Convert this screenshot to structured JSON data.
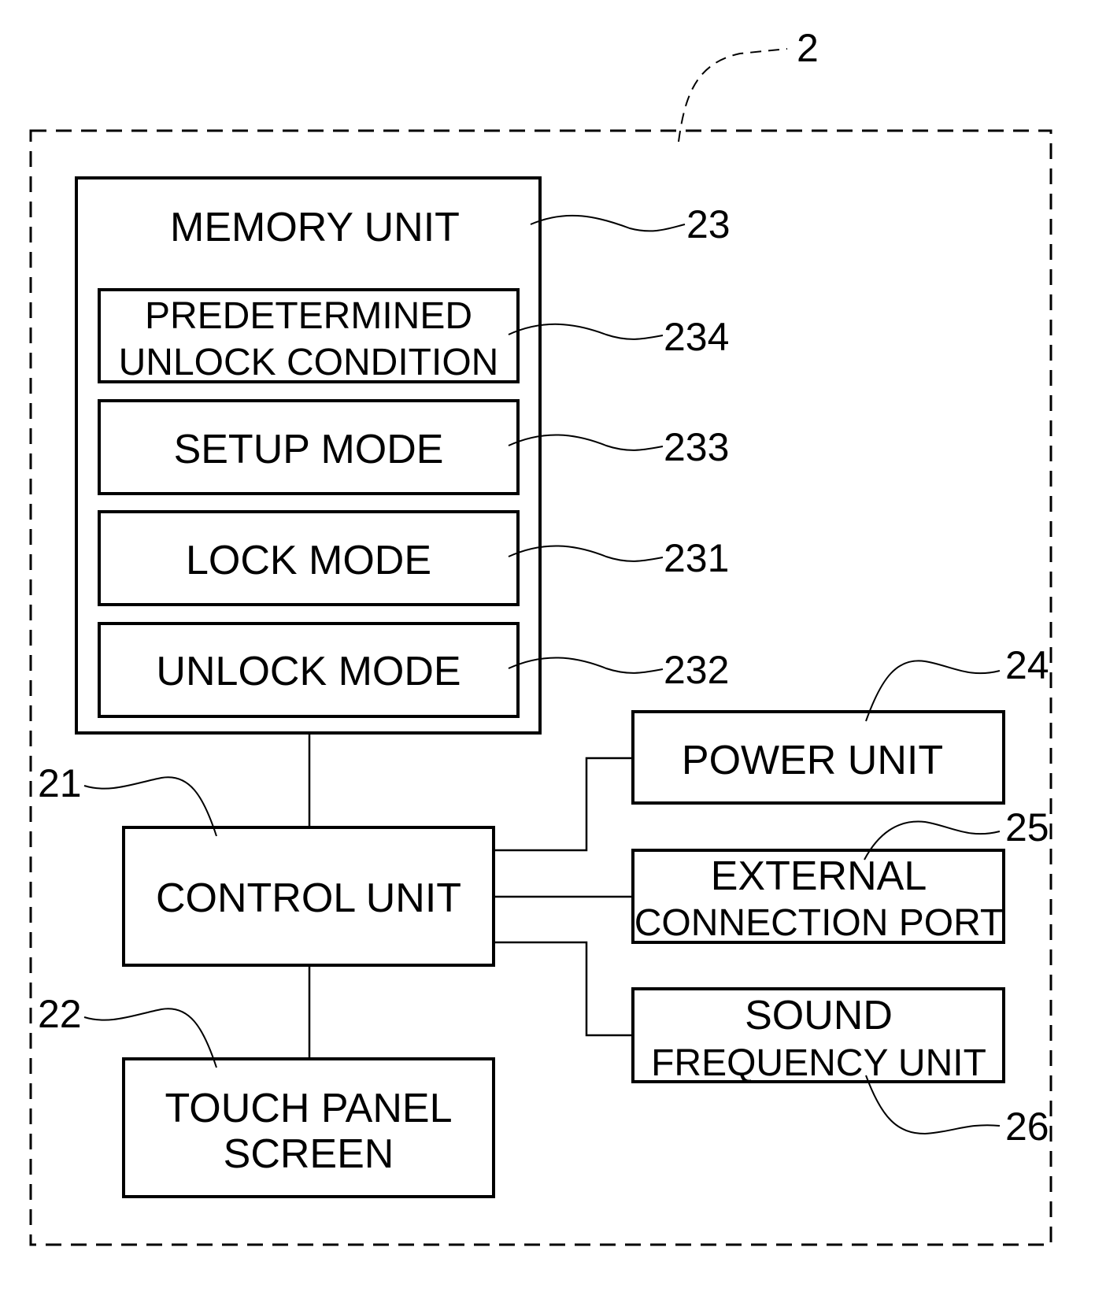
{
  "figure": {
    "device_ref": "2",
    "memory_unit": {
      "label": "MEMORY UNIT",
      "ref": "23"
    },
    "predetermined_unlock_condition": {
      "line1": "PREDETERMINED",
      "line2": "UNLOCK CONDITION",
      "ref": "234"
    },
    "setup_mode": {
      "label": "SETUP MODE",
      "ref": "233"
    },
    "lock_mode": {
      "label": "LOCK MODE",
      "ref": "231"
    },
    "unlock_mode": {
      "label": "UNLOCK MODE",
      "ref": "232"
    },
    "control_unit": {
      "label": "CONTROL UNIT",
      "ref": "21"
    },
    "touch_panel_screen": {
      "line1": "TOUCH PANEL",
      "line2": "SCREEN",
      "ref": "22"
    },
    "power_unit": {
      "label": "POWER UNIT",
      "ref": "24"
    },
    "external_connection_port": {
      "line1": "EXTERNAL",
      "line2": "CONNECTION PORT",
      "ref": "25"
    },
    "sound_frequency_unit": {
      "line1": "SOUND",
      "line2": "FREQUENCY UNIT",
      "ref": "26"
    }
  }
}
